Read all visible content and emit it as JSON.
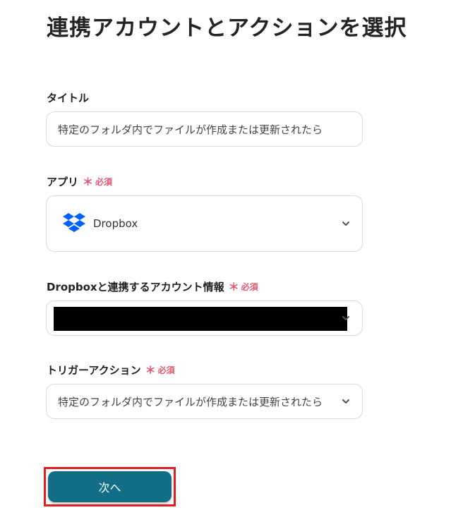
{
  "page": {
    "title": "連携アカウントとアクションを選択"
  },
  "fields": {
    "title": {
      "label": "タイトル",
      "value": "特定のフォルダ内でファイルが作成または更新されたら"
    },
    "app": {
      "label": "アプリ",
      "required_mark": "＊",
      "required_text": "必須",
      "value": "Dropbox",
      "icon": "dropbox-icon",
      "icon_color": "#0061fe"
    },
    "account": {
      "label": "Dropboxと連携するアカウント情報",
      "required_mark": "＊",
      "required_text": "必須"
    },
    "trigger": {
      "label": "トリガーアクション",
      "required_mark": "＊",
      "required_text": "必須",
      "value": "特定のフォルダ内でファイルが作成または更新されたら"
    }
  },
  "actions": {
    "next_label": "次へ"
  },
  "colors": {
    "required": "#e5566f",
    "primary_button": "#126e86",
    "highlight": "#e02020"
  }
}
